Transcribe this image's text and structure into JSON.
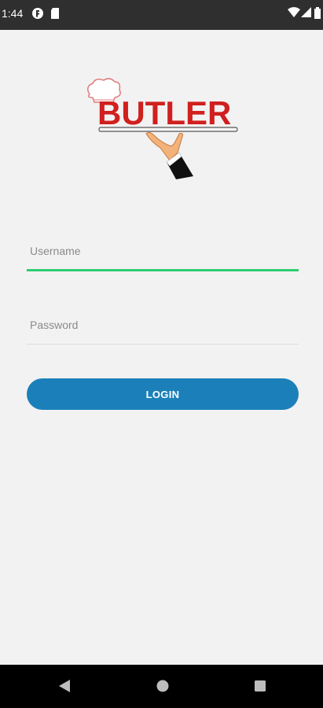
{
  "status_bar": {
    "time": "1:44",
    "icons": [
      "app-notification-icon",
      "sd-card-icon",
      "wifi-icon",
      "signal-icon",
      "battery-icon"
    ]
  },
  "logo": {
    "text": "BUTLER",
    "brand_color": "#d0201f"
  },
  "form": {
    "username_placeholder": "Username",
    "username_value": "",
    "password_placeholder": "Password",
    "password_value": "",
    "login_label": "LOGIN"
  },
  "colors": {
    "background": "#f2f2f2",
    "accent_focus": "#2ecc71",
    "button": "#1b80ba"
  },
  "nav_bar": {
    "buttons": [
      "back-icon",
      "home-icon",
      "recents-icon"
    ]
  }
}
